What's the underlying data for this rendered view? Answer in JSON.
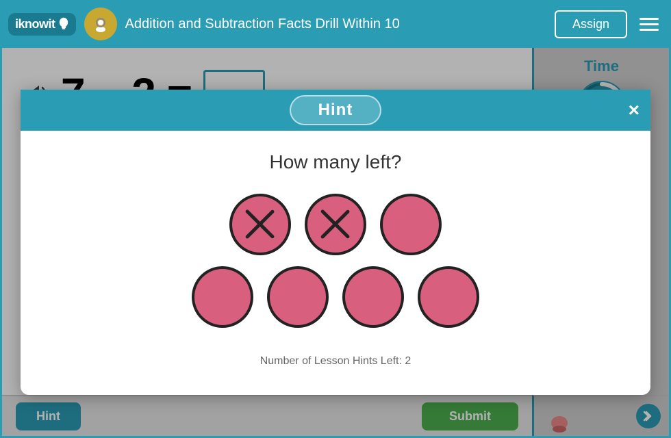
{
  "app": {
    "name": "iknowit",
    "lesson_title": "Addition and Subtraction Facts Drill Within 10"
  },
  "header": {
    "assign_label": "Assign",
    "hamburger_label": "Menu"
  },
  "question": {
    "text": "7 – 2 =",
    "number1": "7",
    "minus": "–",
    "number2": "2",
    "equals": "="
  },
  "right_panel": {
    "time_label": "Time"
  },
  "bottom_bar": {
    "hint_label": "Hint",
    "submit_label": "Submit"
  },
  "modal": {
    "title": "Hint",
    "close_label": "×",
    "hint_question": "How many left?",
    "hint_footer": "Number of Lesson Hints Left: 2",
    "circles": {
      "row1": [
        {
          "crossed": true
        },
        {
          "crossed": true
        },
        {
          "crossed": false
        }
      ],
      "row2": [
        {
          "crossed": false
        },
        {
          "crossed": false
        },
        {
          "crossed": false
        },
        {
          "crossed": false
        }
      ]
    }
  }
}
